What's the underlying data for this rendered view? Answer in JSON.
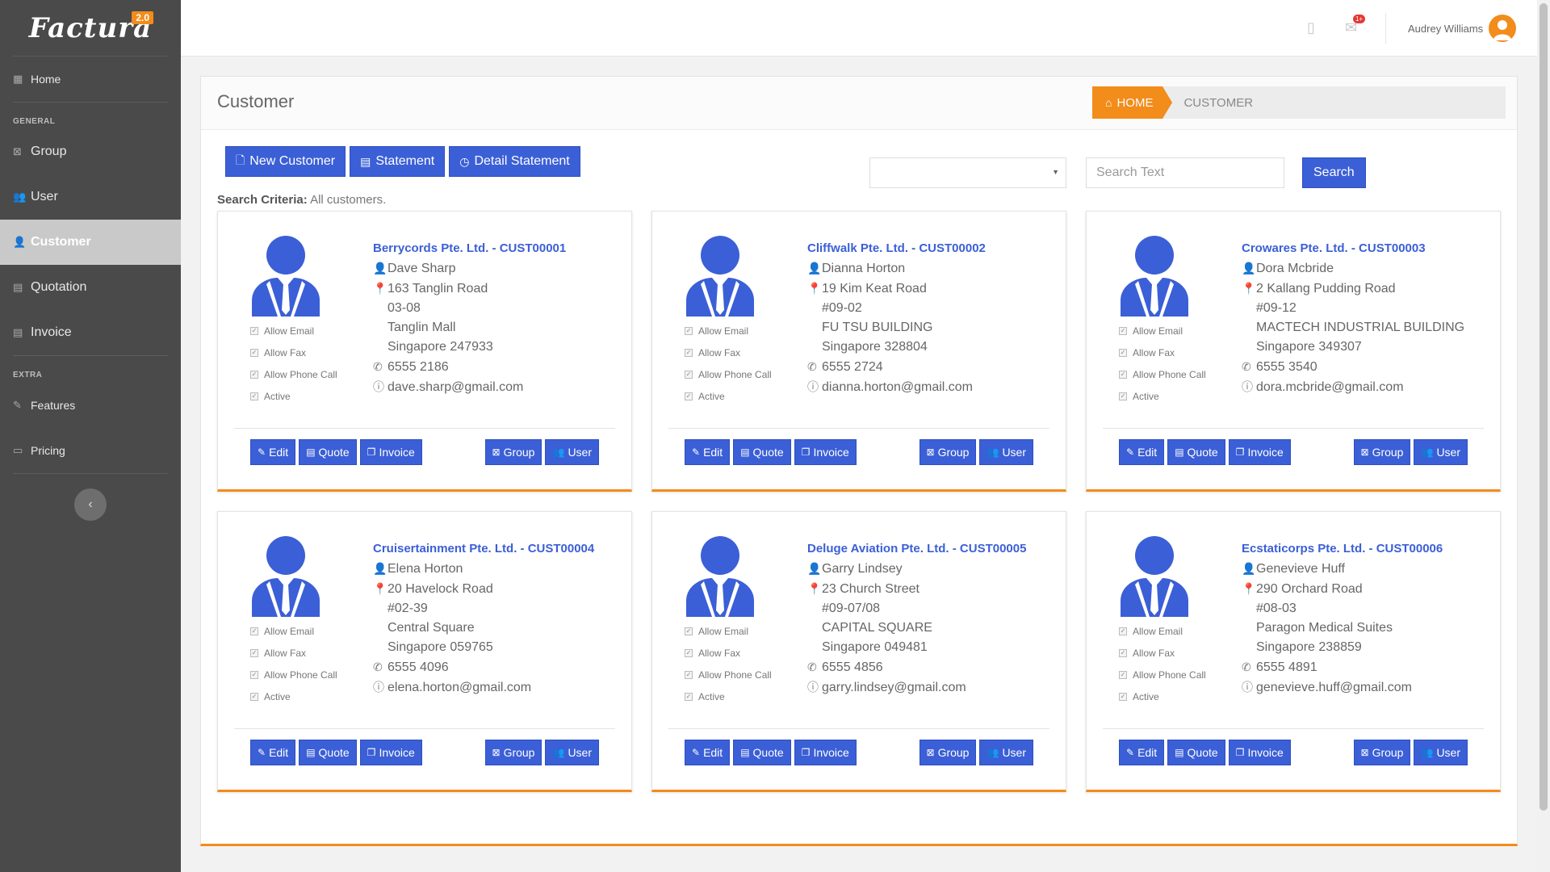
{
  "app": {
    "logo_text": "Factura",
    "logo_version": "2.0"
  },
  "sidebar": {
    "home": "Home",
    "section_general": "GENERAL",
    "group": "Group",
    "user": "User",
    "customer": "Customer",
    "quotation": "Quotation",
    "invoice": "Invoice",
    "section_extra": "EXTRA",
    "features": "Features",
    "pricing": "Pricing"
  },
  "topbar": {
    "user_name": "Audrey Williams",
    "notification_badge": "1+"
  },
  "page": {
    "title": "Customer",
    "breadcrumb_home": "HOME",
    "breadcrumb_current": "CUSTOMER"
  },
  "toolbar": {
    "new_customer": "New Customer",
    "statement": "Statement",
    "detail_statement": "Detail Statement"
  },
  "search": {
    "criteria_label": "Search Criteria:",
    "criteria_value": "All customers.",
    "select_value": "",
    "placeholder": "Search Text",
    "button": "Search"
  },
  "card_labels": {
    "allow_email": "Allow Email",
    "allow_fax": "Allow Fax",
    "allow_phone": "Allow Phone Call",
    "active": "Active",
    "edit": "Edit",
    "quote": "Quote",
    "invoice": "Invoice",
    "group": "Group",
    "user": "User"
  },
  "customers": [
    {
      "title": "Berrycords Pte. Ltd. - CUST00001",
      "contact": "Dave Sharp",
      "address": [
        "163 Tanglin Road",
        "03-08",
        "Tanglin Mall",
        "Singapore 247933"
      ],
      "phone": "6555 2186",
      "email": "dave.sharp@gmail.com"
    },
    {
      "title": "Cliffwalk Pte. Ltd. - CUST00002",
      "contact": "Dianna Horton",
      "address": [
        "19 Kim Keat Road",
        "#09-02",
        "FU TSU BUILDING",
        "Singapore 328804"
      ],
      "phone": "6555 2724",
      "email": "dianna.horton@gmail.com"
    },
    {
      "title": "Crowares Pte. Ltd. - CUST00003",
      "contact": "Dora Mcbride",
      "address": [
        "2 Kallang Pudding Road",
        "#09-12",
        "MACTECH INDUSTRIAL BUILDING",
        "Singapore 349307"
      ],
      "phone": "6555 3540",
      "email": "dora.mcbride@gmail.com"
    },
    {
      "title": "Cruisertainment Pte. Ltd. - CUST00004",
      "contact": "Elena Horton",
      "address": [
        "20 Havelock Road",
        "#02-39",
        "Central Square",
        "Singapore 059765"
      ],
      "phone": "6555 4096",
      "email": "elena.horton@gmail.com"
    },
    {
      "title": "Deluge Aviation Pte. Ltd. - CUST00005",
      "contact": "Garry Lindsey",
      "address": [
        "23 Church Street",
        "#09-07/08",
        "CAPITAL SQUARE",
        "Singapore 049481"
      ],
      "phone": "6555 4856",
      "email": "garry.lindsey@gmail.com"
    },
    {
      "title": "Ecstaticorps Pte. Ltd. - CUST00006",
      "contact": "Genevieve Huff",
      "address": [
        "290 Orchard Road",
        "#08-03",
        "Paragon Medical Suites",
        "Singapore 238859"
      ],
      "phone": "6555 4891",
      "email": "genevieve.huff@gmail.com"
    }
  ],
  "colors": {
    "accent": "#f28c1a",
    "primary": "#3b5fd6",
    "sidebar": "#4a4a4a"
  }
}
